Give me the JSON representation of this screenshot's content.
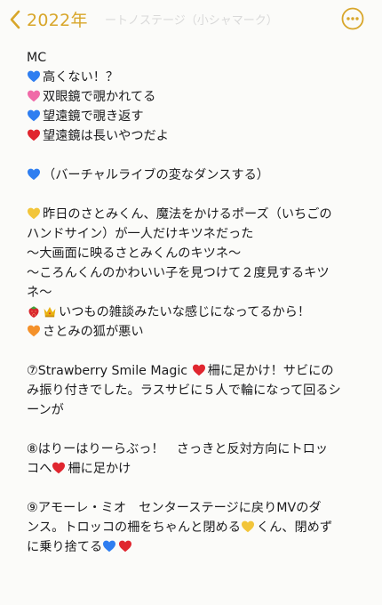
{
  "header": {
    "back_label": "2022年",
    "faded_title": "ートノステージ（小シャマーク）",
    "accent_color": "#d8a62a"
  },
  "note": {
    "lines": [
      {
        "icons": [],
        "text": "MC"
      },
      {
        "icons": [
          "blue-heart-icon"
        ],
        "text": "高くない！？"
      },
      {
        "icons": [
          "pink-heart-icon"
        ],
        "text": "双眼鏡で覗かれてる"
      },
      {
        "icons": [
          "blue-heart-icon"
        ],
        "text": "望遠鏡で覗き返す"
      },
      {
        "icons": [
          "red-heart-icon"
        ],
        "text": "望遠鏡は長いやつだよ"
      },
      {
        "icons": [],
        "text": ""
      },
      {
        "icons": [
          "blue-heart-icon"
        ],
        "text": "（バーチャルライブの変なダンスする）"
      },
      {
        "icons": [],
        "text": ""
      },
      {
        "icons": [
          "yellow-heart-icon"
        ],
        "text": "昨日のさとみくん、魔法をかけるポーズ（いちごの"
      },
      {
        "icons": [],
        "text": "ハンドサイン）が一人だけキツネだった"
      },
      {
        "icons": [],
        "text": "〜大画面に映るさとみくんのキツネ〜"
      },
      {
        "icons": [],
        "text": "〜ころんくんのかわいい子を見つけて２度見するキツ"
      },
      {
        "icons": [],
        "text": "ネ〜"
      },
      {
        "icons": [
          "strawberry-icon",
          "crown-icon"
        ],
        "text": "いつもの雑談みたいな感じになってるから！"
      },
      {
        "icons": [
          "orange-heart-icon"
        ],
        "text": "さとみの狐が悪い"
      },
      {
        "icons": [],
        "text": ""
      },
      {
        "icons": [],
        "text": "⑦Strawberry Smile Magic ",
        "icons_after": [
          "red-heart-icon"
        ],
        "text_after": "柵に足かけ！サビにの"
      },
      {
        "icons": [],
        "text": "み振り付きでした。ラスサビに５人で輪になって回るシ"
      },
      {
        "icons": [],
        "text": "ーンが"
      },
      {
        "icons": [],
        "text": ""
      },
      {
        "icons": [],
        "text": "⑧はりーはりーらぶっ！　さっきと反対方向にトロッ"
      },
      {
        "icons": [],
        "text": "コへ",
        "icons_after": [
          "red-heart-icon"
        ],
        "text_after": "柵に足かけ"
      },
      {
        "icons": [],
        "text": ""
      },
      {
        "icons": [],
        "text": "⑨アモーレ・ミオ　センターステージに戻りMVのダ"
      },
      {
        "icons": [],
        "text": "ンス。トロッコの柵をちゃんと閉める",
        "icons_after": [
          "yellow-heart-icon"
        ],
        "text_after": "くん、閉めず"
      },
      {
        "icons": [],
        "text": "に乗り捨てる",
        "icons_after": [
          "blue-heart-icon",
          "red-heart-icon"
        ],
        "text_after": ""
      }
    ]
  },
  "colors": {
    "blue-heart-icon": "#2f7ef0",
    "pink-heart-icon": "#f06aa8",
    "red-heart-icon": "#e0262f",
    "yellow-heart-icon": "#f2c53a",
    "orange-heart-icon": "#f4912a",
    "strawberry-icon": "#d9262e",
    "crown-icon": "#e9b10f"
  }
}
